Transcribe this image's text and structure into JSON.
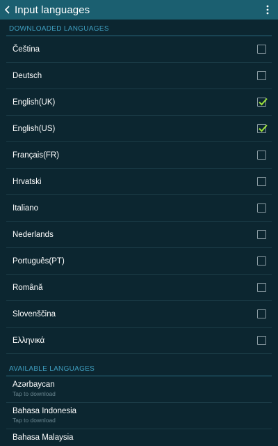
{
  "header": {
    "title": "Input languages"
  },
  "sections": {
    "downloaded_title": "DOWNLOADED LANGUAGES",
    "available_title": "AVAILABLE LANGUAGES"
  },
  "downloaded": [
    {
      "label": "Čeština",
      "checked": false
    },
    {
      "label": "Deutsch",
      "checked": false
    },
    {
      "label": "English(UK)",
      "checked": true
    },
    {
      "label": "English(US)",
      "checked": true
    },
    {
      "label": "Français(FR)",
      "checked": false
    },
    {
      "label": "Hrvatski",
      "checked": false
    },
    {
      "label": "Italiano",
      "checked": false
    },
    {
      "label": "Nederlands",
      "checked": false
    },
    {
      "label": "Português(PT)",
      "checked": false
    },
    {
      "label": "Română",
      "checked": false
    },
    {
      "label": "Slovenščina",
      "checked": false
    },
    {
      "label": "Ελληνικά",
      "checked": false
    }
  ],
  "available": [
    {
      "label": "Azərbaycan",
      "sub": "Tap to download"
    },
    {
      "label": "Bahasa Indonesia",
      "sub": "Tap to download"
    },
    {
      "label": "Bahasa Malaysia",
      "sub": ""
    }
  ],
  "colors": {
    "topbar": "#1b5f70",
    "background": "#0c2630",
    "section_header": "#3f9fc0",
    "check_mark": "#9ee33a"
  }
}
